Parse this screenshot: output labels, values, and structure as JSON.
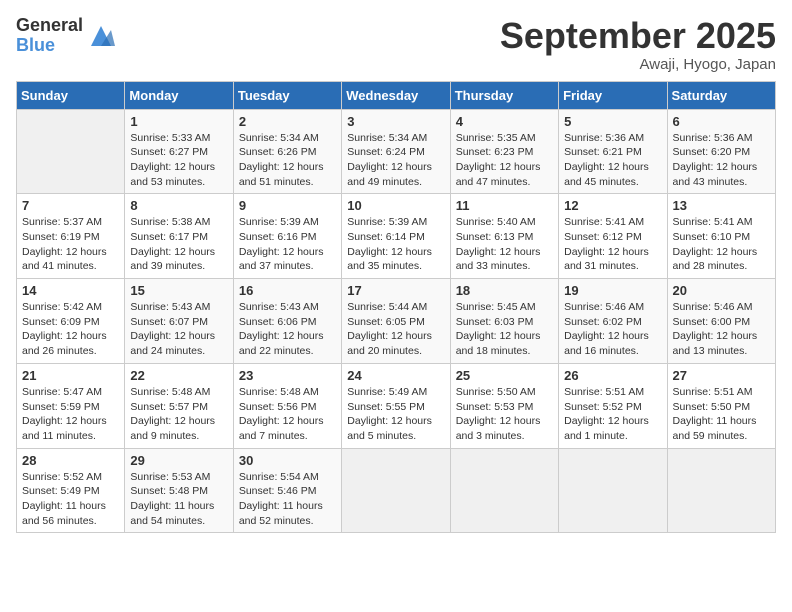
{
  "logo": {
    "general": "General",
    "blue": "Blue"
  },
  "title": "September 2025",
  "location": "Awaji, Hyogo, Japan",
  "days_header": [
    "Sunday",
    "Monday",
    "Tuesday",
    "Wednesday",
    "Thursday",
    "Friday",
    "Saturday"
  ],
  "weeks": [
    [
      {
        "day": "",
        "info": ""
      },
      {
        "day": "1",
        "info": "Sunrise: 5:33 AM\nSunset: 6:27 PM\nDaylight: 12 hours\nand 53 minutes."
      },
      {
        "day": "2",
        "info": "Sunrise: 5:34 AM\nSunset: 6:26 PM\nDaylight: 12 hours\nand 51 minutes."
      },
      {
        "day": "3",
        "info": "Sunrise: 5:34 AM\nSunset: 6:24 PM\nDaylight: 12 hours\nand 49 minutes."
      },
      {
        "day": "4",
        "info": "Sunrise: 5:35 AM\nSunset: 6:23 PM\nDaylight: 12 hours\nand 47 minutes."
      },
      {
        "day": "5",
        "info": "Sunrise: 5:36 AM\nSunset: 6:21 PM\nDaylight: 12 hours\nand 45 minutes."
      },
      {
        "day": "6",
        "info": "Sunrise: 5:36 AM\nSunset: 6:20 PM\nDaylight: 12 hours\nand 43 minutes."
      }
    ],
    [
      {
        "day": "7",
        "info": "Sunrise: 5:37 AM\nSunset: 6:19 PM\nDaylight: 12 hours\nand 41 minutes."
      },
      {
        "day": "8",
        "info": "Sunrise: 5:38 AM\nSunset: 6:17 PM\nDaylight: 12 hours\nand 39 minutes."
      },
      {
        "day": "9",
        "info": "Sunrise: 5:39 AM\nSunset: 6:16 PM\nDaylight: 12 hours\nand 37 minutes."
      },
      {
        "day": "10",
        "info": "Sunrise: 5:39 AM\nSunset: 6:14 PM\nDaylight: 12 hours\nand 35 minutes."
      },
      {
        "day": "11",
        "info": "Sunrise: 5:40 AM\nSunset: 6:13 PM\nDaylight: 12 hours\nand 33 minutes."
      },
      {
        "day": "12",
        "info": "Sunrise: 5:41 AM\nSunset: 6:12 PM\nDaylight: 12 hours\nand 31 minutes."
      },
      {
        "day": "13",
        "info": "Sunrise: 5:41 AM\nSunset: 6:10 PM\nDaylight: 12 hours\nand 28 minutes."
      }
    ],
    [
      {
        "day": "14",
        "info": "Sunrise: 5:42 AM\nSunset: 6:09 PM\nDaylight: 12 hours\nand 26 minutes."
      },
      {
        "day": "15",
        "info": "Sunrise: 5:43 AM\nSunset: 6:07 PM\nDaylight: 12 hours\nand 24 minutes."
      },
      {
        "day": "16",
        "info": "Sunrise: 5:43 AM\nSunset: 6:06 PM\nDaylight: 12 hours\nand 22 minutes."
      },
      {
        "day": "17",
        "info": "Sunrise: 5:44 AM\nSunset: 6:05 PM\nDaylight: 12 hours\nand 20 minutes."
      },
      {
        "day": "18",
        "info": "Sunrise: 5:45 AM\nSunset: 6:03 PM\nDaylight: 12 hours\nand 18 minutes."
      },
      {
        "day": "19",
        "info": "Sunrise: 5:46 AM\nSunset: 6:02 PM\nDaylight: 12 hours\nand 16 minutes."
      },
      {
        "day": "20",
        "info": "Sunrise: 5:46 AM\nSunset: 6:00 PM\nDaylight: 12 hours\nand 13 minutes."
      }
    ],
    [
      {
        "day": "21",
        "info": "Sunrise: 5:47 AM\nSunset: 5:59 PM\nDaylight: 12 hours\nand 11 minutes."
      },
      {
        "day": "22",
        "info": "Sunrise: 5:48 AM\nSunset: 5:57 PM\nDaylight: 12 hours\nand 9 minutes."
      },
      {
        "day": "23",
        "info": "Sunrise: 5:48 AM\nSunset: 5:56 PM\nDaylight: 12 hours\nand 7 minutes."
      },
      {
        "day": "24",
        "info": "Sunrise: 5:49 AM\nSunset: 5:55 PM\nDaylight: 12 hours\nand 5 minutes."
      },
      {
        "day": "25",
        "info": "Sunrise: 5:50 AM\nSunset: 5:53 PM\nDaylight: 12 hours\nand 3 minutes."
      },
      {
        "day": "26",
        "info": "Sunrise: 5:51 AM\nSunset: 5:52 PM\nDaylight: 12 hours\nand 1 minute."
      },
      {
        "day": "27",
        "info": "Sunrise: 5:51 AM\nSunset: 5:50 PM\nDaylight: 11 hours\nand 59 minutes."
      }
    ],
    [
      {
        "day": "28",
        "info": "Sunrise: 5:52 AM\nSunset: 5:49 PM\nDaylight: 11 hours\nand 56 minutes."
      },
      {
        "day": "29",
        "info": "Sunrise: 5:53 AM\nSunset: 5:48 PM\nDaylight: 11 hours\nand 54 minutes."
      },
      {
        "day": "30",
        "info": "Sunrise: 5:54 AM\nSunset: 5:46 PM\nDaylight: 11 hours\nand 52 minutes."
      },
      {
        "day": "",
        "info": ""
      },
      {
        "day": "",
        "info": ""
      },
      {
        "day": "",
        "info": ""
      },
      {
        "day": "",
        "info": ""
      }
    ]
  ]
}
